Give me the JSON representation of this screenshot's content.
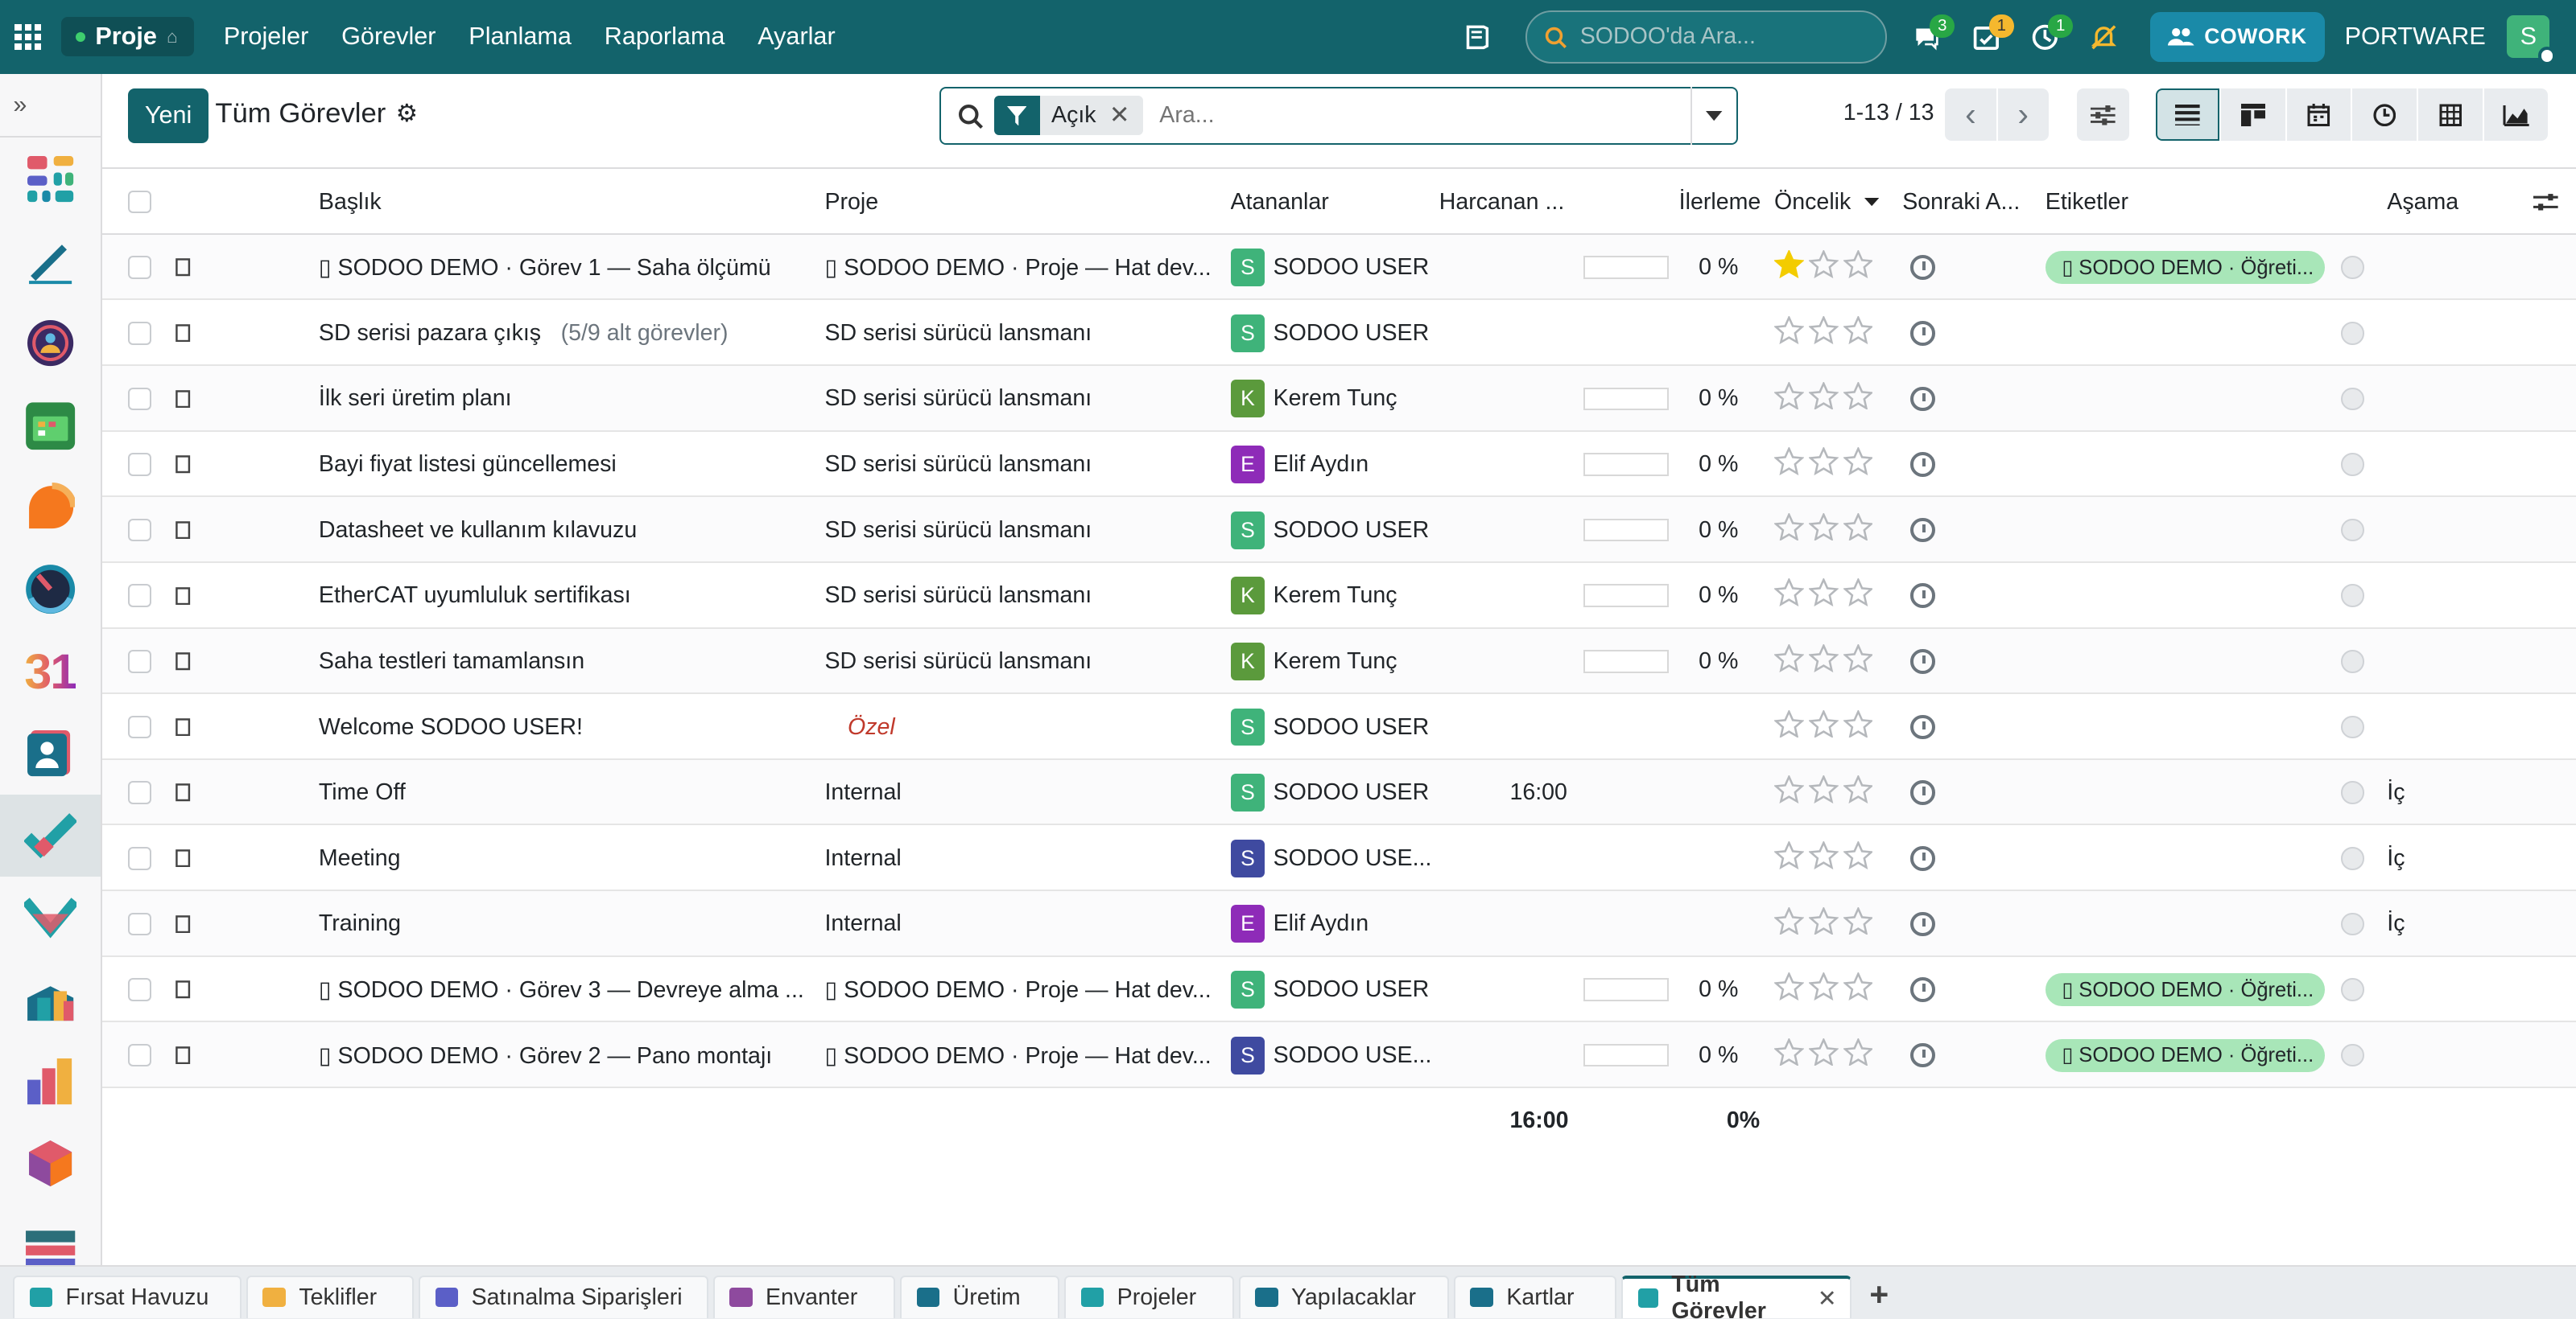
{
  "topbar": {
    "app": "Proje",
    "menu": [
      "Projeler",
      "Görevler",
      "Planlama",
      "Raporlama",
      "Ayarlar"
    ],
    "search_placeholder": "SODOO'da Ara...",
    "badges": {
      "messages": "3",
      "activities": "1",
      "timer": "1"
    },
    "cowork": "COWORK",
    "company": "PORTWARE",
    "user_initial": "S"
  },
  "control": {
    "new": "Yeni",
    "title": "Tüm Görevler",
    "facet": "Açık",
    "search_placeholder": "Ara...",
    "pager": "1-13 / 13"
  },
  "columns": {
    "title": "Başlık",
    "project": "Proje",
    "assignees": "Atananlar",
    "spent": "Harcanan ...",
    "progress": "İlerleme",
    "priority": "Öncelik",
    "next": "Sonraki A...",
    "tags": "Etiketler",
    "stage": "Aşama"
  },
  "rows": [
    {
      "title": "▯ SODOO DEMO · Görev 1 — Saha ölçümü",
      "sub": "",
      "project": "▯ SODOO DEMO · Proje — Hat dev...",
      "proj_style": "",
      "av": "S",
      "avc": "#3fb37a",
      "user": "SODOO USER",
      "spent": "",
      "progress": "0 %",
      "stars": 1,
      "tag": "▯ SODOO DEMO · Öğreti...",
      "stage": ""
    },
    {
      "title": "SD serisi pazara çıkış",
      "sub": "(5/9 alt görevler)",
      "project": "SD serisi sürücü lansmanı",
      "proj_style": "",
      "av": "S",
      "avc": "#3fb37a",
      "user": "SODOO USER",
      "spent": "",
      "progress": "",
      "stars": 0,
      "tag": "",
      "stage": ""
    },
    {
      "title": "İlk seri üretim planı",
      "sub": "",
      "project": "SD serisi sürücü lansmanı",
      "proj_style": "",
      "av": "K",
      "avc": "#5b9a3c",
      "user": "Kerem Tunç",
      "spent": "",
      "progress": "0 %",
      "stars": 0,
      "tag": "",
      "stage": ""
    },
    {
      "title": "Bayi fiyat listesi güncellemesi",
      "sub": "",
      "project": "SD serisi sürücü lansmanı",
      "proj_style": "",
      "av": "E",
      "avc": "#8e2bb8",
      "user": "Elif Aydın",
      "spent": "",
      "progress": "0 %",
      "stars": 0,
      "tag": "",
      "stage": ""
    },
    {
      "title": "Datasheet ve kullanım kılavuzu",
      "sub": "",
      "project": "SD serisi sürücü lansmanı",
      "proj_style": "",
      "av": "S",
      "avc": "#3fb37a",
      "user": "SODOO USER",
      "spent": "",
      "progress": "0 %",
      "stars": 0,
      "tag": "",
      "stage": ""
    },
    {
      "title": "EtherCAT uyumluluk sertifikası",
      "sub": "",
      "project": "SD serisi sürücü lansmanı",
      "proj_style": "",
      "av": "K",
      "avc": "#5b9a3c",
      "user": "Kerem Tunç",
      "spent": "",
      "progress": "0 %",
      "stars": 0,
      "tag": "",
      "stage": ""
    },
    {
      "title": "Saha testleri tamamlansın",
      "sub": "",
      "project": "SD serisi sürücü lansmanı",
      "proj_style": "",
      "av": "K",
      "avc": "#5b9a3c",
      "user": "Kerem Tunç",
      "spent": "",
      "progress": "0 %",
      "stars": 0,
      "tag": "",
      "stage": ""
    },
    {
      "title": "Welcome SODOO USER!",
      "sub": "",
      "project": "Özel",
      "proj_style": "private",
      "av": "S",
      "avc": "#3fb37a",
      "user": "SODOO USER",
      "spent": "",
      "progress": "",
      "stars": 0,
      "tag": "",
      "stage": ""
    },
    {
      "title": "Time Off",
      "sub": "",
      "project": "Internal",
      "proj_style": "",
      "av": "S",
      "avc": "#3fb37a",
      "user": "SODOO USER",
      "spent": "16:00",
      "progress": "",
      "stars": 0,
      "tag": "",
      "stage": "İç"
    },
    {
      "title": "Meeting",
      "sub": "",
      "project": "Internal",
      "proj_style": "",
      "av": "S",
      "avc": "#3f4aa0",
      "user": "SODOO USE...",
      "spent": "",
      "progress": "",
      "stars": 0,
      "tag": "",
      "stage": "İç"
    },
    {
      "title": "Training",
      "sub": "",
      "project": "Internal",
      "proj_style": "",
      "av": "E",
      "avc": "#8e2bb8",
      "user": "Elif Aydın",
      "spent": "",
      "progress": "",
      "stars": 0,
      "tag": "",
      "stage": "İç"
    },
    {
      "title": "▯ SODOO DEMO · Görev 3 — Devreye alma ...",
      "sub": "",
      "project": "▯ SODOO DEMO · Proje — Hat dev...",
      "proj_style": "",
      "av": "S",
      "avc": "#3fb37a",
      "user": "SODOO USER",
      "spent": "",
      "progress": "0 %",
      "stars": 0,
      "tag": "▯ SODOO DEMO · Öğreti...",
      "stage": ""
    },
    {
      "title": "▯ SODOO DEMO · Görev 2 — Pano montajı",
      "sub": "",
      "project": "▯ SODOO DEMO · Proje — Hat dev...",
      "proj_style": "",
      "av": "S",
      "avc": "#3f4aa0",
      "user": "SODOO USE...",
      "spent": "",
      "progress": "0 %",
      "stars": 0,
      "tag": "▯ SODOO DEMO · Öğreti...",
      "stage": ""
    }
  ],
  "footer": {
    "spent": "16:00",
    "progress": "0%"
  },
  "bottom_tabs": [
    "Fırsat Havuzu",
    "Teklifler",
    "Satınalma Siparişleri",
    "Envanter",
    "Üretim",
    "Projeler",
    "Yapılacaklar",
    "Kartlar",
    "Tüm Görevler"
  ],
  "active_tab": "Tüm Görevler"
}
